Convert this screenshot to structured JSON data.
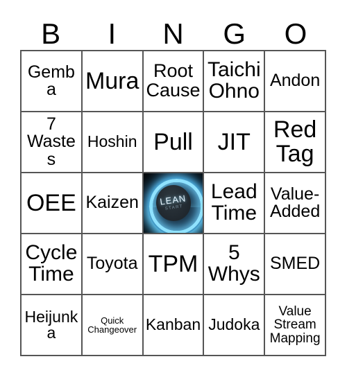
{
  "card": {
    "title_letters": [
      "B",
      "I",
      "N",
      "G",
      "O"
    ],
    "free_space": {
      "label": "LEAN",
      "sublabel": "START",
      "icon": "glowing-ring-button",
      "accent_color": "#8fe2ff",
      "background_color": "#1a2127"
    },
    "grid": {
      "columns": 5,
      "rows": 5,
      "border_color": "#555555",
      "cells": [
        [
          {
            "text": "Gemba",
            "size": "fs-25"
          },
          {
            "text": "Mura",
            "size": "fs-34"
          },
          {
            "text": "Root Cause",
            "size": "fs-27"
          },
          {
            "text": "Taichi Ohno",
            "size": "fs-30"
          },
          {
            "text": "Andon",
            "size": "fs-25"
          }
        ],
        [
          {
            "text": "7 Wastes",
            "size": "fs-25"
          },
          {
            "text": "Hoshin",
            "size": "fs-23"
          },
          {
            "text": "Pull",
            "size": "fs-34"
          },
          {
            "text": "JIT",
            "size": "fs-34"
          },
          {
            "text": "Red Tag",
            "size": "fs-34"
          }
        ],
        [
          {
            "text": "OEE",
            "size": "fs-34"
          },
          {
            "text": "Kaizen",
            "size": "fs-25"
          },
          {
            "text": "LEAN",
            "size": "free"
          },
          {
            "text": "Lead Time",
            "size": "fs-30"
          },
          {
            "text": "Value-Added",
            "size": "fs-25"
          }
        ],
        [
          {
            "text": "Cycle Time",
            "size": "fs-30"
          },
          {
            "text": "Toyota",
            "size": "fs-25"
          },
          {
            "text": "TPM",
            "size": "fs-34"
          },
          {
            "text": "5 Whys",
            "size": "fs-30"
          },
          {
            "text": "SMED",
            "size": "fs-25"
          }
        ],
        [
          {
            "text": "Heijunka",
            "size": "fs-23"
          },
          {
            "text": "Quick Changeover",
            "size": "fs-13"
          },
          {
            "text": "Kanban",
            "size": "fs-23"
          },
          {
            "text": "Judoka",
            "size": "fs-23"
          },
          {
            "text": "Value Stream Mapping",
            "size": "fs-19"
          }
        ]
      ]
    }
  }
}
